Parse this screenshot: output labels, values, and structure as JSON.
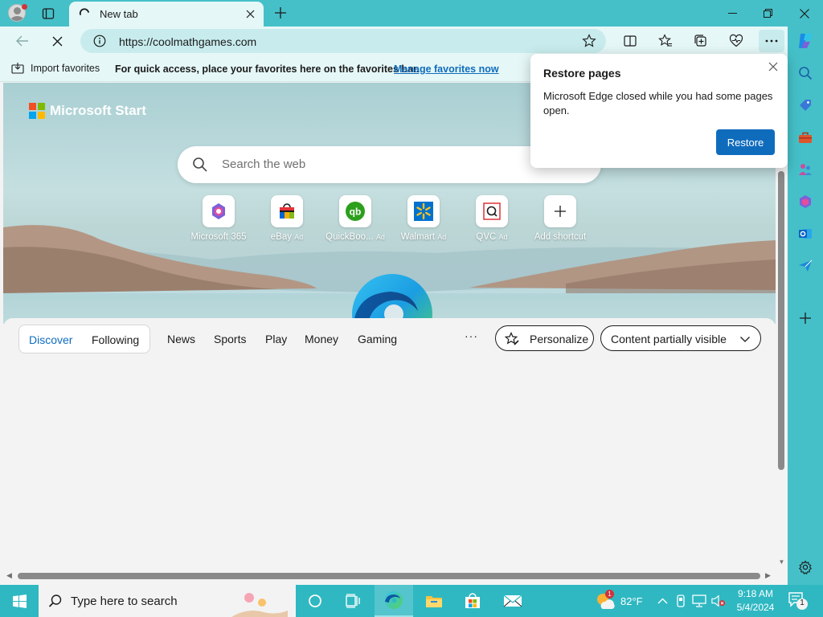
{
  "browser": {
    "tab": {
      "title": "New tab"
    },
    "address": {
      "url": "https://coolmathgames.com"
    },
    "favorites_bar": {
      "import_label": "Import favorites",
      "message": "For quick access, place your favorites here on the favorites bar.",
      "manage_link": "Manage favorites now"
    }
  },
  "newtab": {
    "brand": "Microsoft Start",
    "search_placeholder": "Search the web",
    "quick_links": [
      {
        "label": "Microsoft 365",
        "ad": ""
      },
      {
        "label": "eBay",
        "ad": "Ad"
      },
      {
        "label": "QuickBoo...",
        "ad": "Ad"
      },
      {
        "label": "Walmart",
        "ad": "Ad"
      },
      {
        "label": "QVC",
        "ad": "Ad"
      },
      {
        "label": "Add shortcut",
        "ad": ""
      }
    ],
    "feed_nav": {
      "discover": "Discover",
      "following": "Following",
      "items": [
        "News",
        "Sports",
        "Play",
        "Money",
        "Gaming"
      ],
      "more": "···",
      "personalize": "Personalize",
      "content_visibility": "Content partially visible"
    }
  },
  "popup": {
    "title": "Restore pages",
    "body": "Microsoft Edge closed while you had some pages open.",
    "restore_button": "Restore"
  },
  "taskbar": {
    "search_placeholder": "Type here to search",
    "weather": {
      "temp": "82°F",
      "badge": "1"
    },
    "time": "9:18 AM",
    "date": "5/4/2024",
    "notification_count": "1"
  },
  "colors": {
    "titlebar": "#45c0c8",
    "toolbar": "#e6f7f7",
    "accent": "#0f6cbd",
    "taskbar": "#2fb8c2"
  }
}
